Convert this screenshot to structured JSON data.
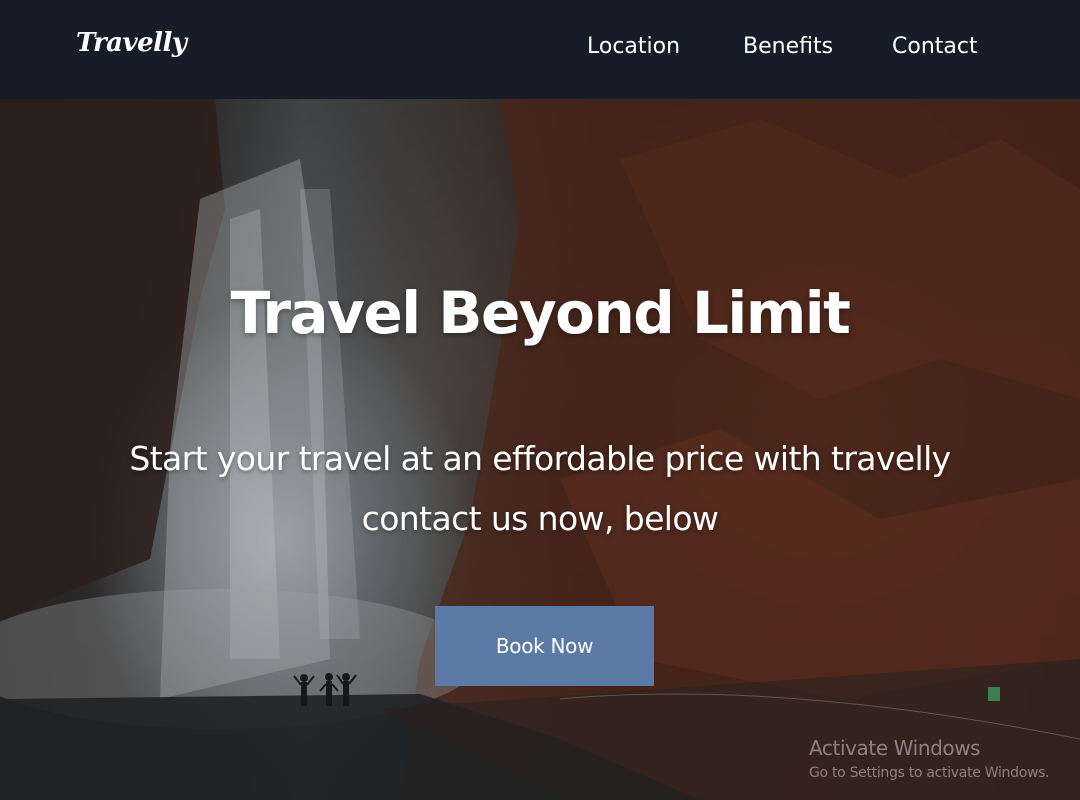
{
  "header": {
    "logo": "Travelly",
    "nav": {
      "location": "Location",
      "benefits": "Benefits",
      "contact": "Contact"
    }
  },
  "hero": {
    "title": "Travel Beyond Limit",
    "subtitle_line1": "Start your travel at an effordable price with travelly",
    "subtitle_line2": "contact us now, below",
    "button_label": "Book Now",
    "scene": "waterfall-with-hikers"
  },
  "watermark": {
    "title": "Activate Windows",
    "subtitle": "Go to Settings to activate Windows."
  },
  "colors": {
    "navbar_bg": "#161d28",
    "button_bg": "#5b7aa5",
    "text": "#ffffff"
  }
}
